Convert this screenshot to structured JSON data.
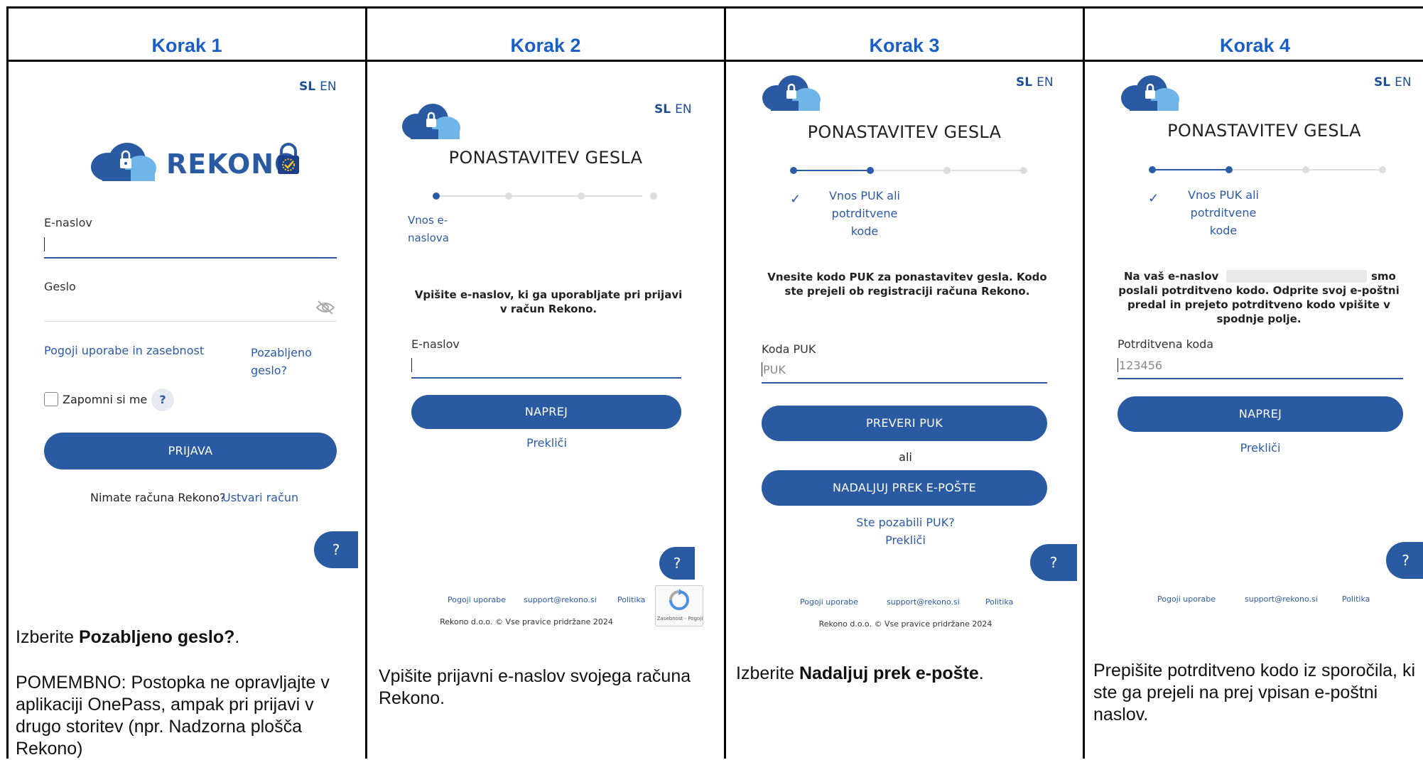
{
  "steps": [
    {
      "header": "Korak 1"
    },
    {
      "header": "Korak 2"
    },
    {
      "header": "Korak 3"
    },
    {
      "header": "Korak 4"
    }
  ],
  "lang": {
    "sl": "SL",
    "en": "EN"
  },
  "colors": {
    "heading_blue": "#1a5fc8",
    "primary_button": "#2a5aa1",
    "link": "#2a5aa8"
  },
  "step1": {
    "brand": "REKONO",
    "email_label": "E-naslov",
    "password_label": "Geslo",
    "terms_link": "Pogoji uporabe in zasebnost",
    "forgot_link_1": "Pozabljeno",
    "forgot_link_2": "geslo?",
    "remember_label": "Zapomni si me",
    "help_small": "?",
    "login_button": "PRIJAVA",
    "no_account": "Nimate računa Rekono?",
    "create_account": "Ustvari račun",
    "help": "?",
    "desc_prefix": "Izberite ",
    "desc_bold": "Pozabljeno geslo?",
    "desc_suffix": ".",
    "desc_note": "POMEMBNO: Postopka ne opravljajte v aplikaciji OnePass, ampak pri prijavi v drugo storitev (npr. Nadzorna plošča Rekono)"
  },
  "step2": {
    "title": "PONASTAVITEV GESLA",
    "step_label_1": "Vnos e-",
    "step_label_2": "naslova",
    "instruction": "Vpišite e-naslov, ki ga uporabljate pri prijavi v račun Rekono.",
    "email_label": "E-naslov",
    "next_button": "NAPREJ",
    "cancel": "Prekliči",
    "help": "?",
    "footer_terms": "Pogoji uporabe",
    "footer_support": "support@rekono.si",
    "footer_policy": "Politika",
    "copyright": "Rekono d.o.o. © Vse pravice pridržane 2024",
    "recaptcha": "Zasebnost - Pogoji",
    "desc": "Vpišite prijavni e-naslov svojega računa Rekono."
  },
  "step3": {
    "title": "PONASTAVITEV GESLA",
    "step_label_1": "Vnos PUK ali",
    "step_label_2": "potrditvene",
    "step_label_3": "kode",
    "instruction": "Vnesite kodo PUK za ponastavitev gesla. Kodo ste prejeli ob registraciji računa Rekono.",
    "puk_label": "Koda PUK",
    "puk_placeholder": "PUK",
    "check_button": "PREVERI PUK",
    "or": "ali",
    "email_button": "NADALJUJ PREK E-POŠTE",
    "forgot_puk": "Ste pozabili PUK?",
    "cancel": "Prekliči",
    "help": "?",
    "footer_terms": "Pogoji uporabe",
    "footer_support": "support@rekono.si",
    "footer_policy": "Politika",
    "copyright": "Rekono d.o.o. © Vse pravice pridržane 2024",
    "desc_prefix": "Izberite ",
    "desc_bold": "Nadaljuj prek e-pošte",
    "desc_suffix": "."
  },
  "step4": {
    "title": "PONASTAVITEV GESLA",
    "step_label_1": "Vnos PUK ali",
    "step_label_2": "potrditvene",
    "step_label_3": "kode",
    "instruction_a": "Na vaš e-naslov",
    "instruction_b": "smo",
    "instruction_c": "poslali potrditveno kodo. Odprite svoj e-poštni predal in prejeto potrditveno kodo vpišite v spodnje polje.",
    "code_label": "Potrditvena koda",
    "code_placeholder": "123456",
    "next_button": "NAPREJ",
    "cancel": "Prekliči",
    "help": "?",
    "footer_terms": "Pogoji uporabe",
    "footer_support": "support@rekono.si",
    "footer_policy": "Politika",
    "desc": "Prepišite potrditveno kodo iz sporočila, ki ste ga prejeli na prej vpisan e-poštni naslov."
  }
}
